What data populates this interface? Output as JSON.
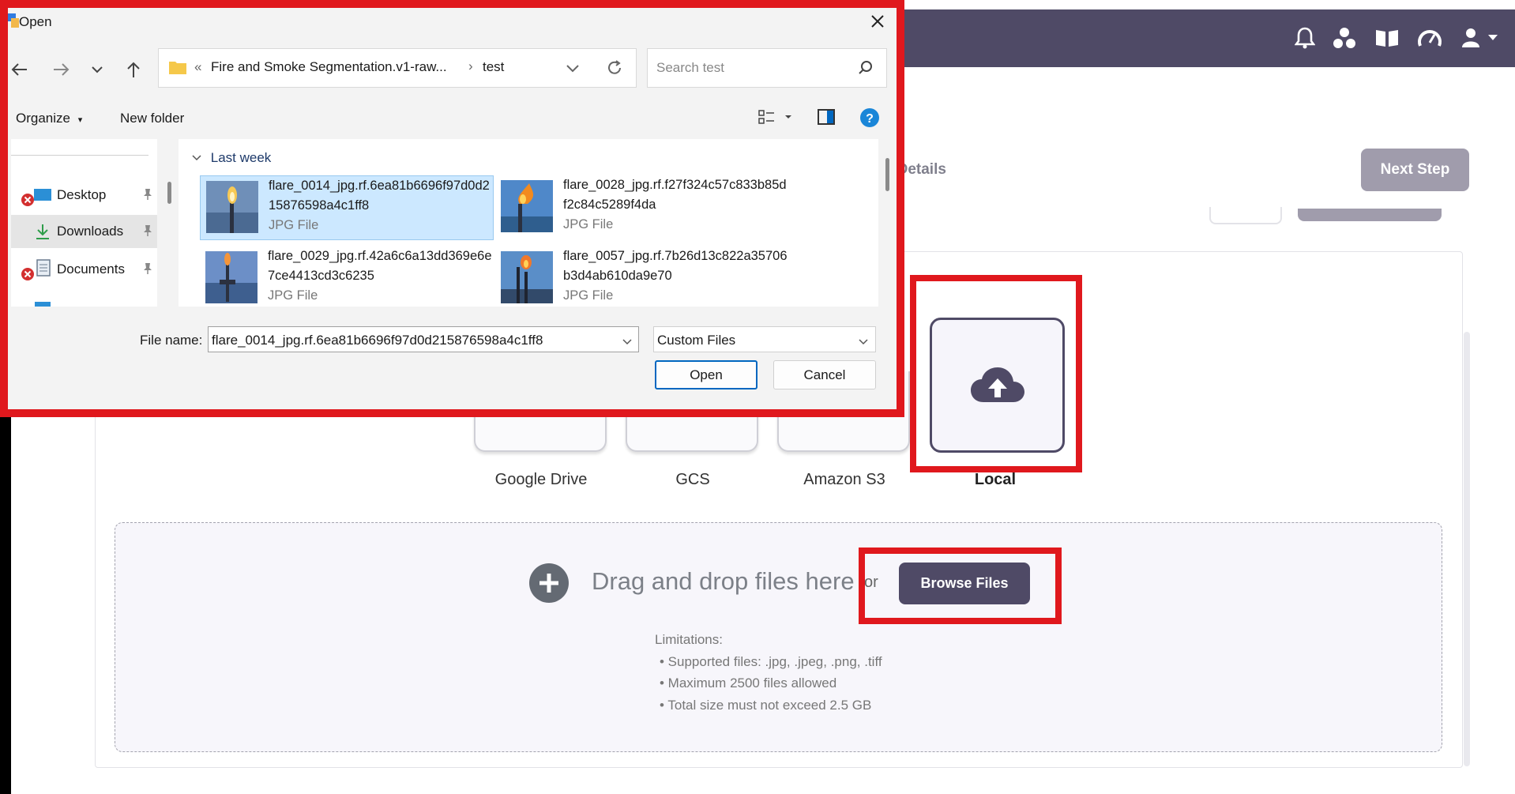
{
  "app": {
    "step_label": "t Details",
    "next_step": "Next Step"
  },
  "sources": {
    "items": [
      {
        "label": "Google Drive"
      },
      {
        "label": "GCS"
      },
      {
        "label": "Amazon S3"
      },
      {
        "label": "Local"
      }
    ]
  },
  "dropzone": {
    "drag_text": "Drag and drop files here",
    "or_text": "or",
    "browse_label": "Browse Files",
    "limitations_title": "Limitations:",
    "limitations": [
      "• Supported files: .jpg, .jpeg, .png, .tiff",
      "• Maximum 2500 files allowed",
      "• Total size must not exceed 2.5 GB"
    ]
  },
  "dialog": {
    "title": "Open",
    "breadcrumb_prefix": "«",
    "breadcrumb_folder": "Fire and Smoke Segmentation.v1-raw...",
    "breadcrumb_sep": "›",
    "breadcrumb_current": "test",
    "search_placeholder": "Search test",
    "organize_label": "Organize",
    "new_folder_label": "New folder",
    "nav_items": [
      {
        "label": "Desktop"
      },
      {
        "label": "Downloads"
      },
      {
        "label": "Documents"
      }
    ],
    "group_label": "Last week",
    "files": [
      {
        "name": "flare_0014_jpg.rf.6ea81b6696f97d0d215876598a4c1ff8",
        "type": "JPG File"
      },
      {
        "name": "flare_0028_jpg.rf.f27f324c57c833b85df2c84c5289f4da",
        "type": "JPG File"
      },
      {
        "name": "flare_0029_jpg.rf.42a6c6a13dd369e6e7ce4413cd3c6235",
        "type": "JPG File"
      },
      {
        "name": "flare_0057_jpg.rf.7b26d13c822a35706b3d4ab610da9e70",
        "type": "JPG File"
      }
    ],
    "filename_label": "File name:",
    "filename_value": "flare_0014_jpg.rf.6ea81b6696f97d0d215876598a4c1ff8",
    "filetype_value": "Custom Files",
    "open_label": "Open",
    "cancel_label": "Cancel"
  },
  "colors": {
    "accent": "#4f4a66",
    "highlight": "#e0181d",
    "selection": "#cce8ff"
  }
}
